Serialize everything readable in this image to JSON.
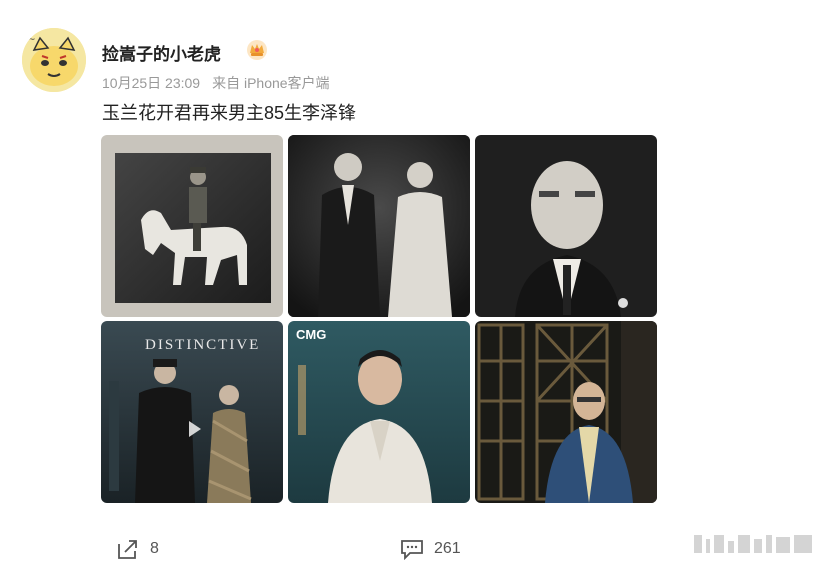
{
  "post": {
    "username": "捡嵩子的小老虎",
    "date": "10月25日 23:09",
    "source": "来自 iPhone客户端",
    "text": "玉兰花开君再来男主85生李泽锋"
  },
  "photos": {
    "p1": {
      "icon": "horse-rider-photo"
    },
    "p2": {
      "icon": "couple-photo"
    },
    "p3": {
      "icon": "portrait-photo"
    },
    "p4": {
      "title": "DISTINCTIVE",
      "icon": "couple-poster-photo"
    },
    "p5": {
      "logo": "CMG",
      "icon": "actor-portrait-photo"
    },
    "p6": {
      "icon": "actor-lattice-photo"
    }
  },
  "actions": {
    "share_count": "8",
    "comment_count": "261"
  },
  "colors": {
    "text": "#222222",
    "meta": "#999999",
    "badge": "#f2a93b"
  }
}
